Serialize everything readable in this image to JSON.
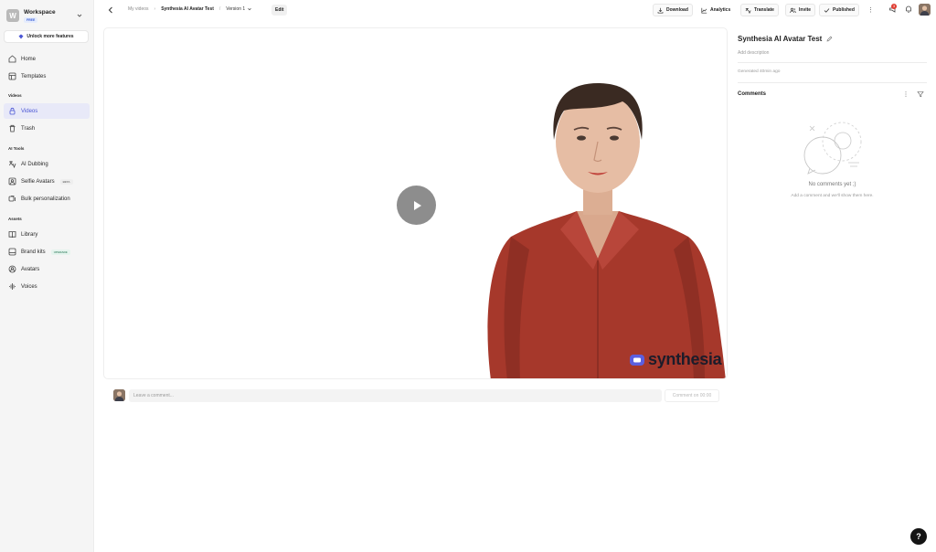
{
  "workspace": {
    "name": "Workspace",
    "plan": "FREE",
    "initial": "W"
  },
  "sidebar": {
    "unlock_label": "Unlock more features",
    "home": "Home",
    "templates": "Templates",
    "section_videos": "Videos",
    "videos": "Videos",
    "trash": "Trash",
    "section_ai_tools": "AI Tools",
    "ai_dubbing": "AI Dubbing",
    "selfie_avatars": "Selfie Avatars",
    "selfie_badge": "BETA",
    "bulk_personalization": "Bulk personalization",
    "section_assets": "Assets",
    "library": "Library",
    "brand_kits": "Brand kits",
    "brand_badge": "UPGRADE",
    "avatars": "Avatars",
    "voices": "Voices"
  },
  "breadcrumb": {
    "root": "My videos",
    "title": "Synthesia AI Avatar Test",
    "version": "Version 1",
    "edit": "Edit"
  },
  "toolbar": {
    "download": "Download",
    "analytics": "Analytics",
    "translate": "Translate",
    "invite": "Invite",
    "published": "Published",
    "notification_count": "3"
  },
  "video": {
    "watermark": "synthesia"
  },
  "comment_bar": {
    "placeholder": "Leave a comment...",
    "submit": "Comment on 00:00"
  },
  "panel": {
    "title": "Synthesia AI Avatar Test",
    "description_placeholder": "Add description",
    "generated": "Generated 40min ago",
    "comments_heading": "Comments",
    "empty_title": "No comments yet ;)",
    "empty_subtitle": "Add a comment and we'll show them here."
  },
  "help": {
    "label": "?"
  },
  "colors": {
    "accent": "#4a55d4",
    "shirt": "#a8392c",
    "badge_red": "#e03c31"
  }
}
